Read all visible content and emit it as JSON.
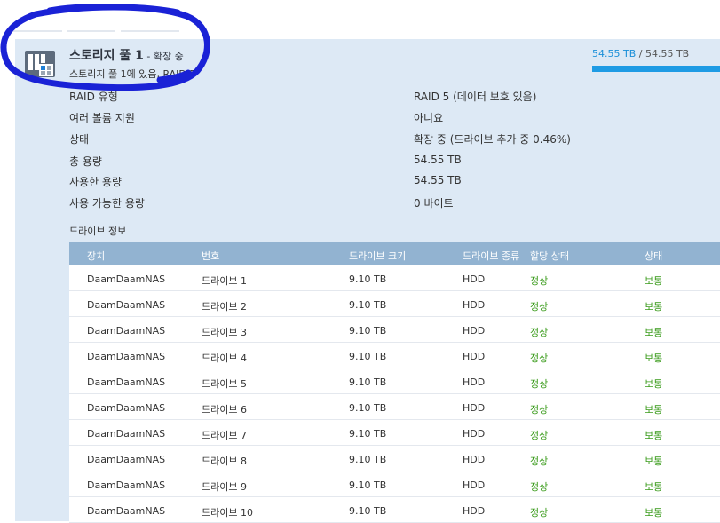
{
  "pool": {
    "title": "스토리지 풀 1",
    "status": " - 확장 중",
    "subtitle": "스토리지 풀 1에 있음, RAID 5",
    "capacity_used": "54.55 TB",
    "capacity_sep": " / ",
    "capacity_total": "54.55 TB",
    "capacity_fill": 1.0
  },
  "properties": [
    {
      "label": "RAID 유형",
      "value": "RAID 5 (데이터 보호 있음)"
    },
    {
      "label": "여러 볼륨 지원",
      "value": "아니요"
    },
    {
      "label": "상태",
      "value": "확장 중 (드라이브 추가 중 0.46%)"
    },
    {
      "label": "총 용량",
      "value": "54.55 TB"
    },
    {
      "label": "사용한 용량",
      "value": "54.55 TB"
    },
    {
      "label": "사용 가능한 용량",
      "value": "0 바이트"
    }
  ],
  "drive_section_title": "드라이브 정보",
  "table": {
    "headers": [
      "장치",
      "번호",
      "드라이브 크기",
      "드라이브 종류",
      "할당 상태",
      "상태"
    ],
    "rows": [
      [
        "DaamDaamNAS",
        "드라이브 1",
        "9.10 TB",
        "HDD",
        "정상",
        "보통"
      ],
      [
        "DaamDaamNAS",
        "드라이브 2",
        "9.10 TB",
        "HDD",
        "정상",
        "보통"
      ],
      [
        "DaamDaamNAS",
        "드라이브 3",
        "9.10 TB",
        "HDD",
        "정상",
        "보통"
      ],
      [
        "DaamDaamNAS",
        "드라이브 4",
        "9.10 TB",
        "HDD",
        "정상",
        "보통"
      ],
      [
        "DaamDaamNAS",
        "드라이브 5",
        "9.10 TB",
        "HDD",
        "정상",
        "보통"
      ],
      [
        "DaamDaamNAS",
        "드라이브 6",
        "9.10 TB",
        "HDD",
        "정상",
        "보통"
      ],
      [
        "DaamDaamNAS",
        "드라이브 7",
        "9.10 TB",
        "HDD",
        "정상",
        "보통"
      ],
      [
        "DaamDaamNAS",
        "드라이브 8",
        "9.10 TB",
        "HDD",
        "정상",
        "보통"
      ],
      [
        "DaamDaamNAS",
        "드라이브 9",
        "9.10 TB",
        "HDD",
        "정상",
        "보통"
      ],
      [
        "DaamDaamNAS",
        "드라이브 10",
        "9.10 TB",
        "HDD",
        "정상",
        "보통"
      ]
    ]
  },
  "colors": {
    "panel_bg": "#dde9f5",
    "header_bg": "#92b3d1",
    "accent": "#1e9be4",
    "ok_green": "#3a9b1b",
    "annotation": "#1a22d6"
  },
  "icons": {
    "pool": "storage-pool-icon"
  }
}
